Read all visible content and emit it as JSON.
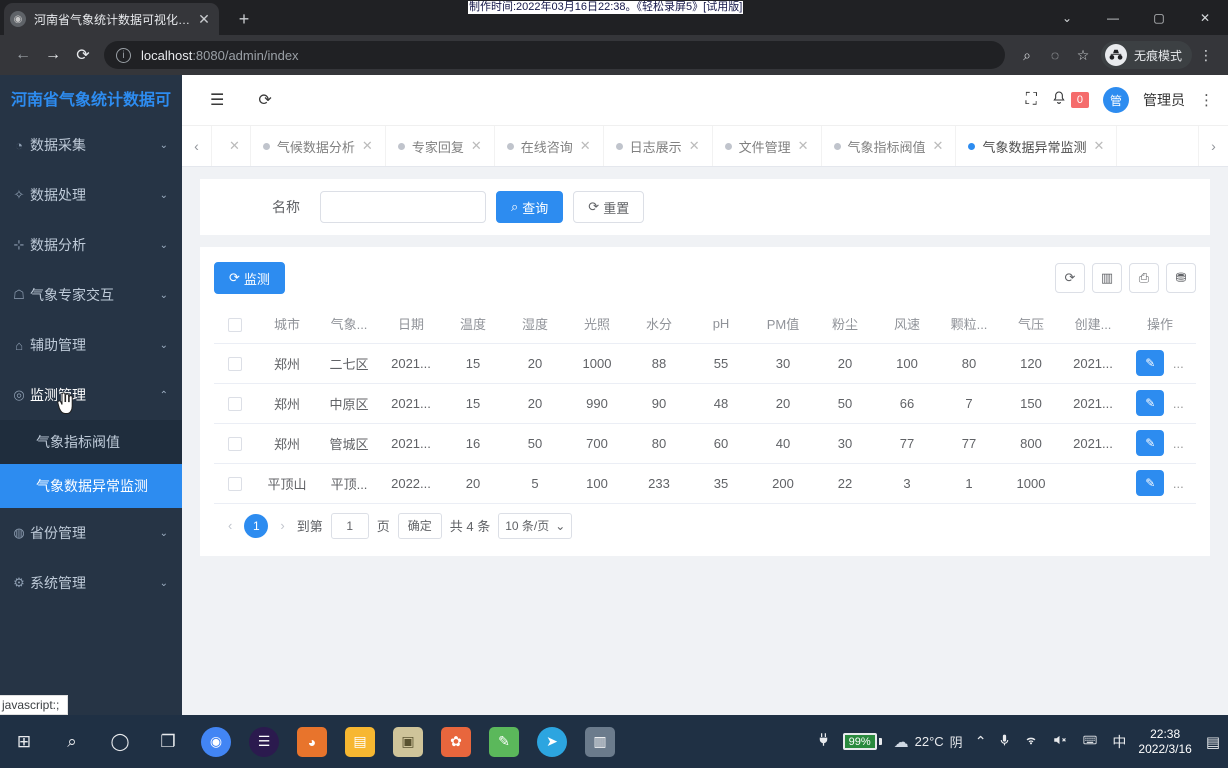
{
  "browser": {
    "tab_title": "河南省气象统计数据可视化系统",
    "tab_close": "✕",
    "new_tab": "+",
    "back": "←",
    "forward": "→",
    "reload": "⟳",
    "url_host": "localhost",
    "url_path": ":8080/admin/index",
    "info_icon": "i",
    "zoom_icon": "⌕",
    "eye_icon": "◌",
    "star_icon": "☆",
    "incognito_label": "无痕模式",
    "win_minimize": "—",
    "win_maximize": "▢",
    "win_close": "✕",
    "win_chevron": "⌄"
  },
  "watermark": "制作时间:2022年03月16日22:38。《轻松录屏5》[试用版]",
  "sidebar": {
    "title": "河南省气象统计数据可",
    "items": [
      {
        "icon": "◔",
        "label": "数据采集",
        "arrow": "⌄",
        "open": false
      },
      {
        "icon": "✧",
        "label": "数据处理",
        "arrow": "⌄",
        "open": false
      },
      {
        "icon": "⊹",
        "label": "数据分析",
        "arrow": "⌄",
        "open": false
      },
      {
        "icon": "☖",
        "label": "气象专家交互",
        "arrow": "⌄",
        "open": false
      },
      {
        "icon": "⌂",
        "label": "辅助管理",
        "arrow": "⌄",
        "open": false
      },
      {
        "icon": "◎",
        "label": "监测管理",
        "arrow": "⌃",
        "open": true
      },
      {
        "icon": "◍",
        "label": "省份管理",
        "arrow": "⌄",
        "open": false
      },
      {
        "icon": "⚙",
        "label": "系统管理",
        "arrow": "⌄",
        "open": false
      }
    ],
    "submenu": [
      {
        "label": "气象指标阀值",
        "active": false
      },
      {
        "label": "气象数据异常监测",
        "active": true
      }
    ]
  },
  "header": {
    "collapse_icon": "☰",
    "refresh_icon": "⟳",
    "fullscreen_icon": "⛶",
    "bell_icon": "🔔",
    "notification_count": "0",
    "avatar_text": "管",
    "user_name": "管理员",
    "kebab_icon": "⋮"
  },
  "page_tabs": {
    "left_arrow": "‹",
    "right_arrow": "›",
    "close_icon": "✕",
    "items": [
      {
        "label": "",
        "active": false
      },
      {
        "label": "气候数据分析",
        "active": false
      },
      {
        "label": "专家回复",
        "active": false
      },
      {
        "label": "在线咨询",
        "active": false
      },
      {
        "label": "日志展示",
        "active": false
      },
      {
        "label": "文件管理",
        "active": false
      },
      {
        "label": "气象指标阀值",
        "active": false
      },
      {
        "label": "气象数据异常监测",
        "active": true
      }
    ]
  },
  "filter": {
    "label": "名称",
    "input_value": "",
    "input_placeholder": "",
    "search_icon": "⌕",
    "search_label": "查询",
    "reset_icon": "⟳",
    "reset_label": "重置"
  },
  "table_toolbar": {
    "monitor_icon": "⟳",
    "monitor_label": "监测",
    "icons": [
      {
        "name": "refresh-icon",
        "glyph": "⟳"
      },
      {
        "name": "columns-icon",
        "glyph": "▥"
      },
      {
        "name": "print-icon",
        "glyph": "⎙"
      },
      {
        "name": "export-icon",
        "glyph": "⛃"
      }
    ]
  },
  "table": {
    "columns": [
      "城市",
      "气象...",
      "日期",
      "温度",
      "湿度",
      "光照",
      "水分",
      "pH",
      "PM值",
      "粉尘",
      "风速",
      "颗粒...",
      "气压",
      "创建...",
      "操作"
    ],
    "rows": [
      {
        "cells": [
          "郑州",
          "二七区",
          "2021...",
          "15",
          "20",
          "1000",
          "88",
          "55",
          "30",
          "20",
          "100",
          "80",
          "120",
          "2021..."
        ],
        "edit": "✎",
        "more": "..."
      },
      {
        "cells": [
          "郑州",
          "中原区",
          "2021...",
          "15",
          "20",
          "990",
          "90",
          "48",
          "20",
          "50",
          "66",
          "7",
          "150",
          "2021..."
        ],
        "edit": "✎",
        "more": "..."
      },
      {
        "cells": [
          "郑州",
          "管城区",
          "2021...",
          "16",
          "50",
          "700",
          "80",
          "60",
          "40",
          "30",
          "77",
          "77",
          "800",
          "2021..."
        ],
        "edit": "✎",
        "more": "..."
      },
      {
        "cells": [
          "平顶山",
          "平顶...",
          "2022...",
          "20",
          "5",
          "100",
          "233",
          "35",
          "200",
          "22",
          "3",
          "1",
          "1000",
          ""
        ],
        "edit": "✎",
        "more": "..."
      }
    ]
  },
  "pagination": {
    "prev": "‹",
    "current_page": "1",
    "next": "›",
    "goto_label": "到第",
    "goto_value": "1",
    "page_unit": "页",
    "confirm_label": "确定",
    "total_label": "共 4 条",
    "page_size": "10 条/页",
    "chevron": "⌄"
  },
  "status_bar": {
    "text": "javascript:;"
  },
  "taskbar": {
    "start_icon": "⊞",
    "search_icon": "⌕",
    "cortana_icon": "◯",
    "taskview_icon": "❐",
    "apps": [
      {
        "name": "chrome",
        "glyph": "◉",
        "color": "#4285f4"
      },
      {
        "name": "edge-dev",
        "glyph": "☰",
        "color": "#2b1a4e"
      },
      {
        "name": "wechat",
        "glyph": "◕",
        "color": "#3fae36"
      },
      {
        "name": "file-explorer",
        "glyph": "▤",
        "color": "#f7b731"
      },
      {
        "name": "folder",
        "glyph": "▣",
        "color": "#d9d0a0"
      },
      {
        "name": "settings",
        "glyph": "✿",
        "color": "#e8663d"
      },
      {
        "name": "editor",
        "glyph": "✎",
        "color": "#5bb85b"
      },
      {
        "name": "telegram",
        "glyph": "➤",
        "color": "#2ca5e0"
      },
      {
        "name": "screen-recorder",
        "glyph": "▥",
        "color": "#6b7b8c"
      }
    ],
    "plug_icon": "🔌",
    "battery_percent": "99%",
    "weather_icon": "☁",
    "weather_temp": "22°C",
    "weather_desc": "阴",
    "chevron_up": "⌃",
    "mic_icon": "🎙",
    "wifi_icon": "📶",
    "volume_icon": "🔇",
    "keyboard_icon": "⌨",
    "ime_icon": "中",
    "time": "22:38",
    "date": "2022/3/16",
    "notification_icon": "▤"
  }
}
